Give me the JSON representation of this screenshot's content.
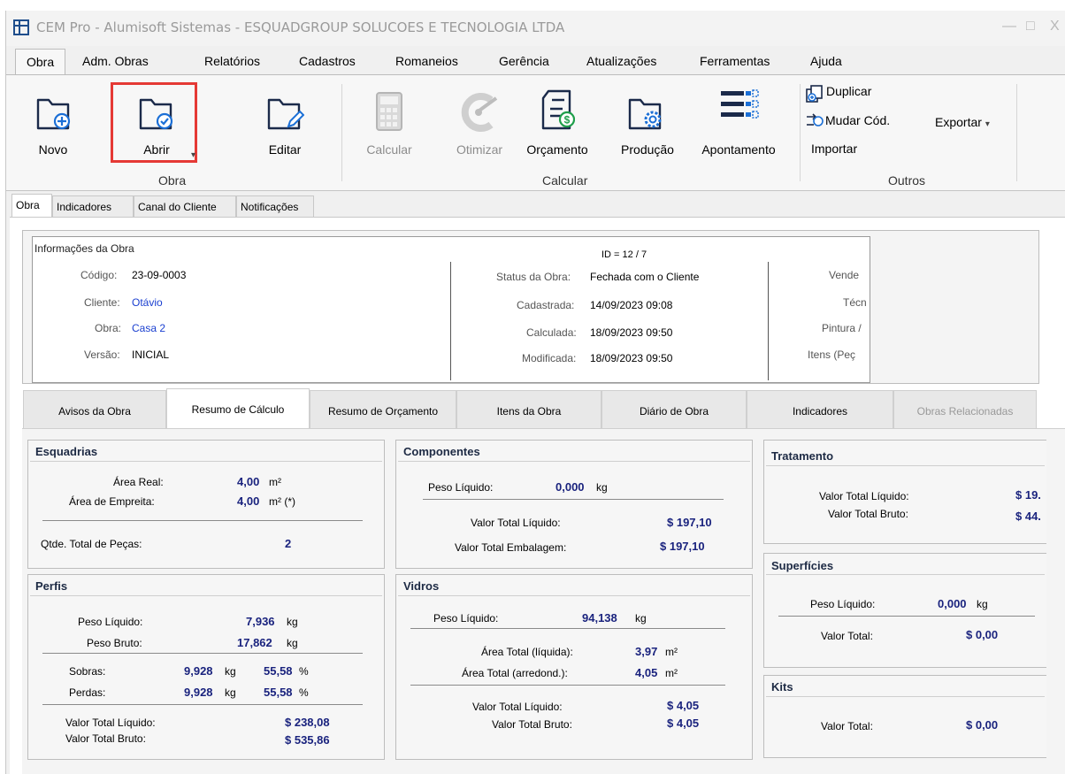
{
  "window": {
    "title": "CEM Pro - Alumisoft Sistemas - ESQUADGROUP SOLUCOES E TECNOLOGIA LTDA",
    "minimize": "—",
    "maximize": "□",
    "close": "X"
  },
  "menu": [
    "Obra",
    "Adm. Obras",
    "Relatórios",
    "Cadastros",
    "Romaneios",
    "Gerência",
    "Atualizações",
    "Ferramentas",
    "Ajuda"
  ],
  "ribbon": {
    "novo": "Novo",
    "abrir": "Abrir",
    "editar": "Editar",
    "calcular": "Calcular",
    "otimizar": "Otimizar",
    "orcamento": "Orçamento",
    "producao": "Produção",
    "apontamento": "Apontamento",
    "duplicar": "Duplicar",
    "mudar_cod": "Mudar Cód.",
    "exportar": "Exportar",
    "importar": "Importar",
    "dropdown_glyph": "▾",
    "groups": {
      "obra": "Obra",
      "calcular": "Calcular",
      "outros": "Outros"
    }
  },
  "top_tabs": [
    "Obra",
    "Indicadores",
    "Canal do Cliente",
    "Notificações"
  ],
  "info": {
    "header": "Informações da Obra",
    "id": "ID = 12 / 7",
    "codigo_label": "Código:",
    "codigo": "23-09-0003",
    "cliente_label": "Cliente:",
    "cliente": "Otávio",
    "obra_label": "Obra:",
    "obra": "Casa 2",
    "versao_label": "Versão:",
    "versao": "INICIAL",
    "status_label": "Status da Obra:",
    "status": "Fechada com o Cliente",
    "cadastrada_label": "Cadastrada:",
    "cadastrada": "14/09/2023 09:08",
    "calculada_label": "Calculada:",
    "calculada": "18/09/2023 09:50",
    "modificada_label": "Modificada:",
    "modificada": "18/09/2023 09:50",
    "vende": "Vende",
    "tecn": "Técn",
    "pintura": "Pintura /",
    "itens": "Itens (Peç"
  },
  "sub_tabs": [
    "Avisos da Obra",
    "Resumo de Cálculo",
    "Resumo de Orçamento",
    "Itens da Obra",
    "Diário de Obra",
    "Indicadores",
    "Obras Relacionadas"
  ],
  "esquadrias": {
    "title": "Esquadrias",
    "area_real_label": "Área Real:",
    "area_real": "4,00",
    "area_real_unit": "m²",
    "area_emp_label": "Área de Empreita:",
    "area_emp": "4,00",
    "area_emp_unit": "m²  (*)",
    "qtde_label": "Qtde. Total de Peças:",
    "qtde": "2"
  },
  "perfis": {
    "title": "Perfis",
    "peso_liq_label": "Peso Líquido:",
    "peso_liq": "7,936",
    "peso_liq_unit": "kg",
    "peso_bruto_label": "Peso Bruto:",
    "peso_bruto": "17,862",
    "peso_bruto_unit": "kg",
    "sobras_label": "Sobras:",
    "sobras_kg": "9,928",
    "sobras_kg_unit": "kg",
    "sobras_pct": "55,58",
    "sobras_pct_unit": "%",
    "perdas_label": "Perdas:",
    "perdas_kg": "9,928",
    "perdas_kg_unit": "kg",
    "perdas_pct": "55,58",
    "perdas_pct_unit": "%",
    "vtl_label": "Valor Total Líquido:",
    "vtl": "$ 238,08",
    "vtb_label": "Valor Total Bruto:",
    "vtb": "$ 535,86"
  },
  "componentes": {
    "title": "Componentes",
    "peso_label": "Peso Líquido:",
    "peso": "0,000",
    "peso_unit": "kg",
    "vtl_label": "Valor Total Líquido:",
    "vtl": "$ 197,10",
    "vte_label": "Valor Total Embalagem:",
    "vte": "$ 197,10"
  },
  "vidros": {
    "title": "Vidros",
    "peso_label": "Peso Líquido:",
    "peso": "94,138",
    "peso_unit": "kg",
    "at_liq_label": "Área Total (líquida):",
    "at_liq": "3,97",
    "at_liq_unit": "m²",
    "at_arr_label": "Área Total (arredond.):",
    "at_arr": "4,05",
    "at_arr_unit": "m²",
    "vtl_label": "Valor Total Líquido:",
    "vtl": "$ 4,05",
    "vtb_label": "Valor Total Bruto:",
    "vtb": "$ 4,05"
  },
  "tratamento": {
    "title": "Tratamento",
    "vtl_label": "Valor Total Líquido:",
    "vtl": "$ 19.",
    "vtb_label": "Valor Total Bruto:",
    "vtb": "$ 44."
  },
  "superficies": {
    "title": "Superfícies",
    "peso_label": "Peso Líquido:",
    "peso": "0,000",
    "peso_unit": "kg",
    "vt_label": "Valor Total:",
    "vt": "$ 0,00"
  },
  "kits": {
    "title": "Kits",
    "vt_label": "Valor Total:",
    "vt": "$ 0,00"
  }
}
